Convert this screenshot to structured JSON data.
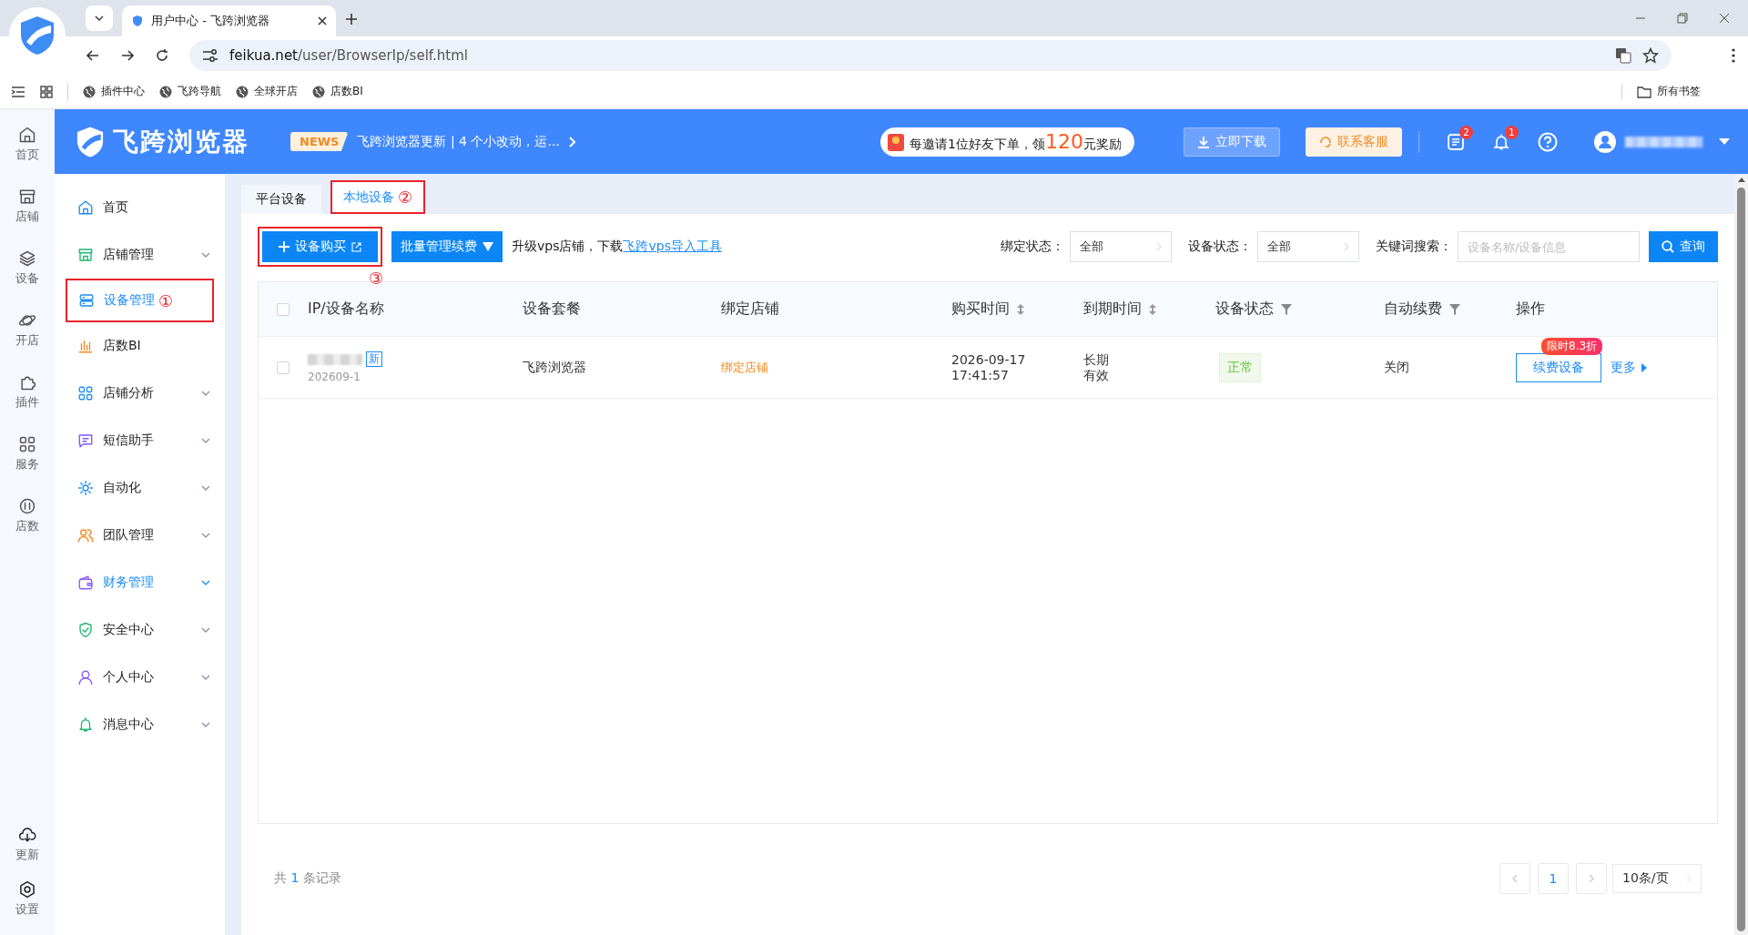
{
  "browser": {
    "tab_title": "用户中心 - 飞跨浏览器",
    "url_domain": "feikua.net",
    "url_path": "/user/BrowserIp/self.html",
    "bookmarks": [
      "插件中心",
      "飞跨导航",
      "全球开店",
      "店数BI"
    ],
    "all_bookmarks": "所有书签"
  },
  "header": {
    "logo": "飞跨浏览器",
    "news_badge": "NEWS",
    "news_text": "飞跨浏览器更新 | 4 个小改动，运...",
    "promo_prefix": "每邀请1位好友下单，领",
    "promo_amount": "120",
    "promo_suffix": "元奖励",
    "download": "立即下载",
    "support": "联系客服",
    "doc_count": "2",
    "bell_count": "1"
  },
  "rail": {
    "top": [
      {
        "label": "首页",
        "kind": "home"
      },
      {
        "label": "店铺",
        "kind": "shop"
      },
      {
        "label": "设备",
        "kind": "layers"
      },
      {
        "label": "开店",
        "kind": "planet"
      },
      {
        "label": "插件",
        "kind": "puzzle"
      },
      {
        "label": "服务",
        "kind": "grid"
      },
      {
        "label": "店数",
        "kind": "bi"
      }
    ],
    "bottom": [
      {
        "label": "更新",
        "kind": "cloud"
      },
      {
        "label": "设置",
        "kind": "gear"
      }
    ]
  },
  "sidebar": [
    {
      "label": "首页",
      "kind": "home",
      "expandable": false,
      "highlighted": false
    },
    {
      "label": "店铺管理",
      "kind": "shop",
      "expandable": true,
      "highlighted": false
    },
    {
      "label": "设备管理",
      "kind": "server",
      "expandable": false,
      "highlighted": true,
      "annotation": "①"
    },
    {
      "label": "店数BI",
      "kind": "chart",
      "expandable": false,
      "highlighted": false
    },
    {
      "label": "店铺分析",
      "kind": "grid",
      "expandable": true,
      "highlighted": false
    },
    {
      "label": "短信助手",
      "kind": "message",
      "expandable": true,
      "highlighted": false
    },
    {
      "label": "自动化",
      "kind": "sun",
      "expandable": true,
      "highlighted": false
    },
    {
      "label": "团队管理",
      "kind": "team",
      "expandable": true,
      "highlighted": false
    },
    {
      "label": "财务管理",
      "kind": "wallet",
      "expandable": true,
      "highlighted": true
    },
    {
      "label": "安全中心",
      "kind": "shield",
      "expandable": true,
      "highlighted": false
    },
    {
      "label": "个人中心",
      "kind": "user",
      "expandable": true,
      "highlighted": false
    },
    {
      "label": "消息中心",
      "kind": "bell",
      "expandable": true,
      "highlighted": false
    }
  ],
  "tabs": [
    {
      "label": "平台设备",
      "selected": false
    },
    {
      "label": "本地设备",
      "selected": true,
      "annotation": "②"
    }
  ],
  "toolbar": {
    "buy_button": "设备购买",
    "buy_annotation": "③",
    "batch_button": "批量管理续费",
    "vps_text": "升级vps店铺，下载",
    "vps_link": "飞跨vps导入工具",
    "filters": [
      {
        "label": "绑定状态：",
        "value": "全部"
      },
      {
        "label": "设备状态：",
        "value": "全部"
      }
    ],
    "search": {
      "label": "关键词搜索：",
      "placeholder": "设备名称/设备信息"
    },
    "query": "查询"
  },
  "table": {
    "header_checked": false,
    "columns": [
      {
        "label": "IP/设备名称",
        "kind": "plain"
      },
      {
        "label": "设备套餐",
        "kind": "plain"
      },
      {
        "label": "绑定店铺",
        "kind": "plain"
      },
      {
        "label": "购买时间",
        "kind": "sort"
      },
      {
        "label": "到期时间",
        "kind": "sort"
      },
      {
        "label": "设备状态",
        "kind": "filter"
      },
      {
        "label": "自动续费",
        "kind": "filter"
      },
      {
        "label": "操作",
        "kind": "plain"
      }
    ],
    "rows": [
      {
        "checked": false,
        "device_id": "202609-1",
        "new_tag": "新",
        "package": "飞跨浏览器",
        "bind_link": "绑定店铺",
        "buy_time": "2026-09-17 17:41:57",
        "expiry": "长期有效",
        "status": "正常",
        "auto_renew": "关闭",
        "renew_button": "续费设备",
        "discount": "限时8.3折",
        "more": "更多"
      }
    ]
  },
  "footer": {
    "total_prefix": "共",
    "total_count": "1",
    "total_suffix": "条记录",
    "page": "1",
    "page_size": "10条/页"
  }
}
